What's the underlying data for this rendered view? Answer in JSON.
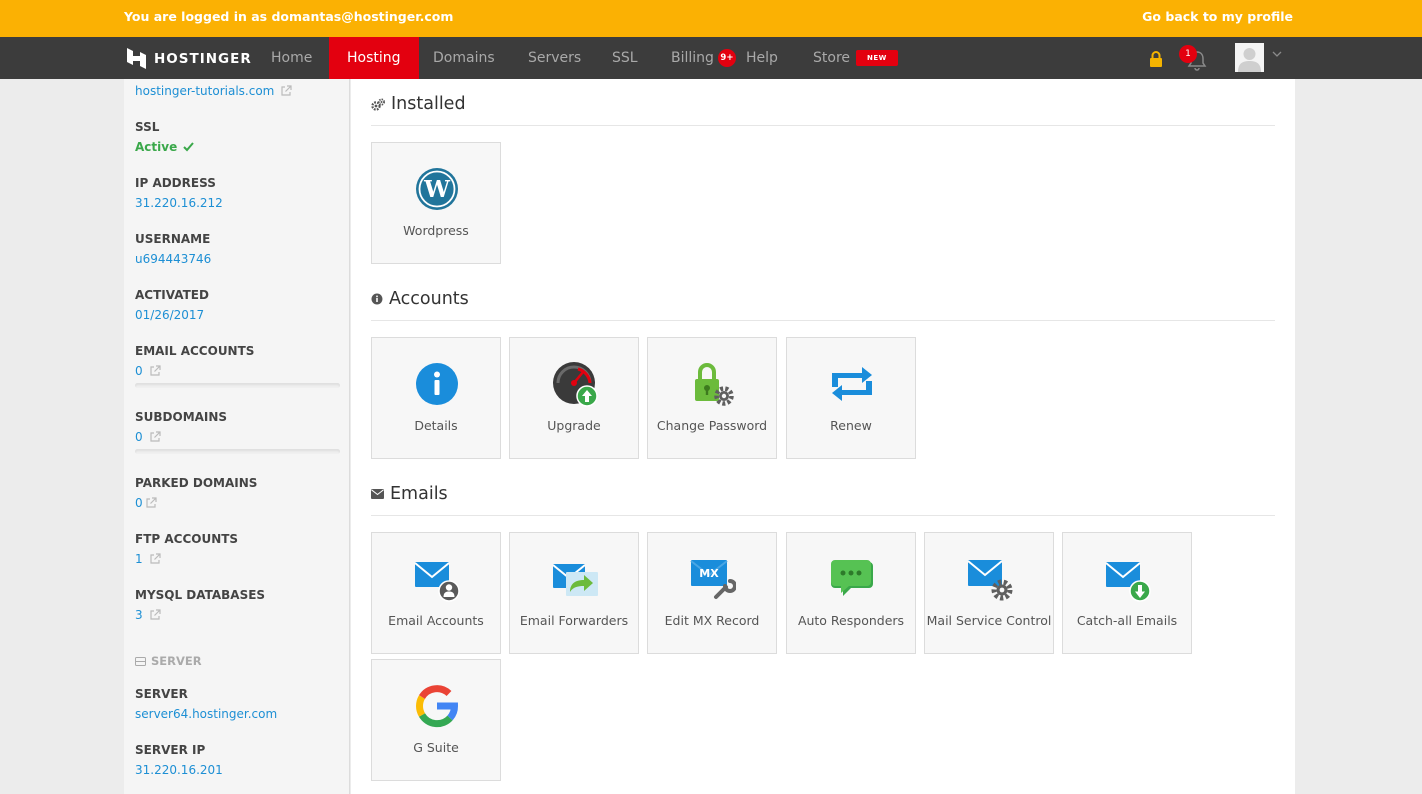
{
  "banner": {
    "message": "You are logged in as domantas@hostinger.com",
    "back_link": "Go back to my profile"
  },
  "nav": {
    "logo_text": "HOSTINGER",
    "items": {
      "home": "Home",
      "hosting": "Hosting",
      "domains": "Domains",
      "servers": "Servers",
      "ssl": "SSL",
      "billing": "Billing",
      "billing_badge": "9+",
      "help": "Help",
      "store": "Store",
      "store_badge": "NEW"
    },
    "notifications_count": "1"
  },
  "sidebar": {
    "domain": "hostinger-tutorials.com",
    "ssl_label": "SSL",
    "ssl_value": "Active",
    "ip_label": "IP ADDRESS",
    "ip_value": "31.220.16.212",
    "username_label": "USERNAME",
    "username_value": "u694443746",
    "activated_label": "ACTIVATED",
    "activated_value": "01/26/2017",
    "email_label": "EMAIL ACCOUNTS",
    "email_value": "0",
    "subdomains_label": "SUBDOMAINS",
    "subdomains_value": "0",
    "parked_label": "PARKED DOMAINS",
    "parked_value": "0",
    "ftp_label": "FTP ACCOUNTS",
    "ftp_value": "1",
    "mysql_label": "MYSQL DATABASES",
    "mysql_value": "3",
    "server_section": "SERVER",
    "server_label": "SERVER",
    "server_value": "server64.hostinger.com",
    "server_ip_label": "SERVER IP",
    "server_ip_value": "31.220.16.201"
  },
  "sections": {
    "installed": {
      "title": "Installed",
      "tiles": {
        "wordpress": "Wordpress"
      }
    },
    "accounts": {
      "title": "Accounts",
      "tiles": {
        "details": "Details",
        "upgrade": "Upgrade",
        "change_password": "Change Password",
        "renew": "Renew"
      }
    },
    "emails": {
      "title": "Emails",
      "tiles": {
        "email_accounts": "Email Accounts",
        "email_forwarders": "Email Forwarders",
        "edit_mx": "Edit MX Record",
        "mx_badge": "MX",
        "auto_responders": "Auto Responders",
        "mail_service": "Mail Service Control",
        "catch_all": "Catch-all Emails",
        "gsuite": "G Suite"
      }
    }
  },
  "colors": {
    "banner": "#fbb103",
    "nav_bg": "#3c3c3c",
    "accent_red": "#e3000f",
    "link_blue": "#1d8fd4",
    "active_green": "#3aa84a"
  }
}
